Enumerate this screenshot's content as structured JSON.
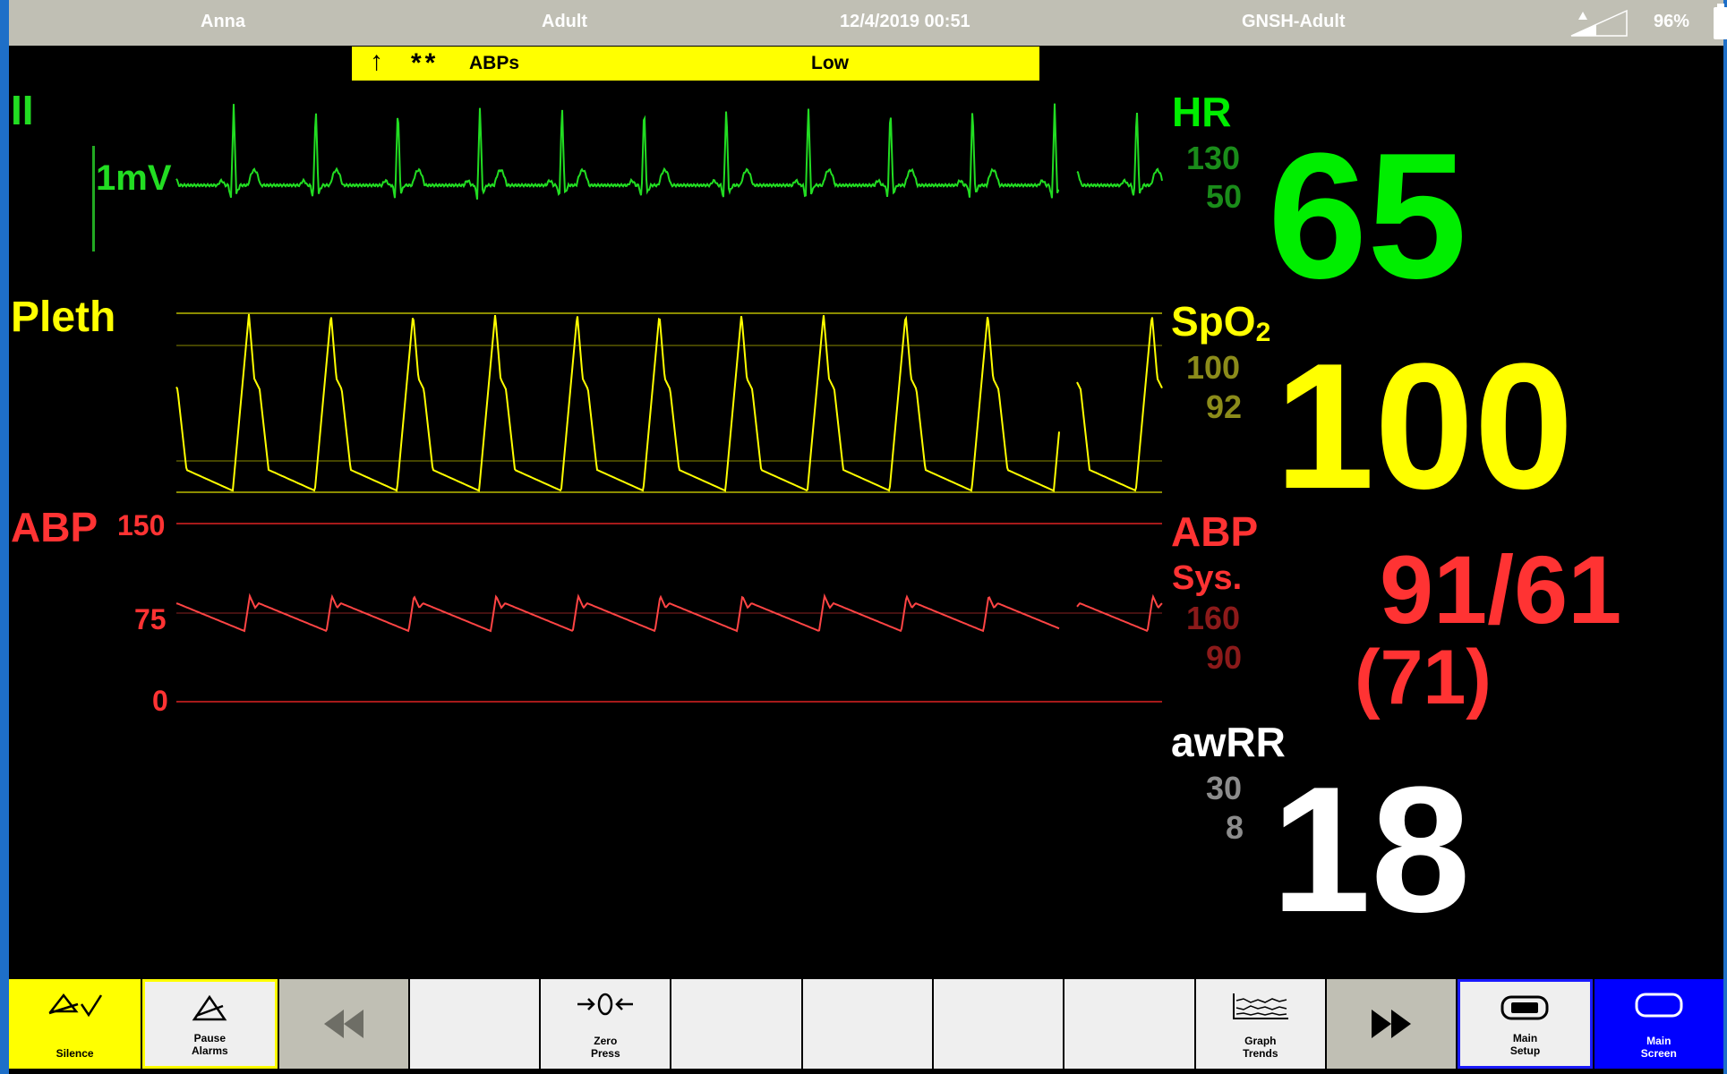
{
  "status_bar": {
    "patient_name": "Anna",
    "patient_type": "Adult",
    "datetime": "12/4/2019 00:51",
    "profile": "GNSH-Adult",
    "battery": "96%"
  },
  "alarm_banner": {
    "arrow": "↑",
    "priority": "**",
    "source": "ABPs",
    "message": "Low"
  },
  "ecg": {
    "lead": "II",
    "scale": "1mV",
    "color": "#22dd22"
  },
  "pleth": {
    "label": "Pleth",
    "color": "#ffff00"
  },
  "abp_wave": {
    "label": "ABP",
    "scale_high": "150",
    "scale_mid": "75",
    "scale_low": "0",
    "color": "#ff3333"
  },
  "vitals": {
    "hr": {
      "label": "HR",
      "high_limit": "130",
      "low_limit": "50",
      "value": "65",
      "color": "#00ee00",
      "limit_color": "#1a8c1a"
    },
    "spo2": {
      "label": "SpO",
      "label_sub": "2",
      "high_limit": "100",
      "low_limit": "92",
      "value": "100",
      "color": "#ffff00",
      "limit_color": "#8c8c1a"
    },
    "abp": {
      "label": "ABP",
      "sub_label": "Sys.",
      "high_limit": "160",
      "low_limit": "90",
      "value": "91/61",
      "mean": "(71)",
      "color": "#ff3333",
      "limit_color": "#8c1a1a"
    },
    "awrr": {
      "label": "awRR",
      "high_limit": "30",
      "low_limit": "8",
      "value": "18",
      "color": "#ffffff",
      "limit_color": "#8c8c8c"
    }
  },
  "softkeys": [
    {
      "label": "Silence",
      "icon": "silence-icon"
    },
    {
      "label": "Pause\nAlarms",
      "icon": "pause-alarms-icon"
    },
    {
      "label": "",
      "icon": "rewind-icon"
    },
    {
      "label": "",
      "icon": ""
    },
    {
      "label": "Zero\nPress",
      "icon": "zero-pressure-icon"
    },
    {
      "label": "",
      "icon": ""
    },
    {
      "label": "",
      "icon": ""
    },
    {
      "label": "",
      "icon": ""
    },
    {
      "label": "",
      "icon": ""
    },
    {
      "label": "Graph\nTrends",
      "icon": "graph-trends-icon"
    },
    {
      "label": "",
      "icon": "fast-forward-icon"
    },
    {
      "label": "Main\nSetup",
      "icon": "main-setup-icon"
    },
    {
      "label": "Main\nScreen",
      "icon": "main-screen-icon"
    }
  ]
}
